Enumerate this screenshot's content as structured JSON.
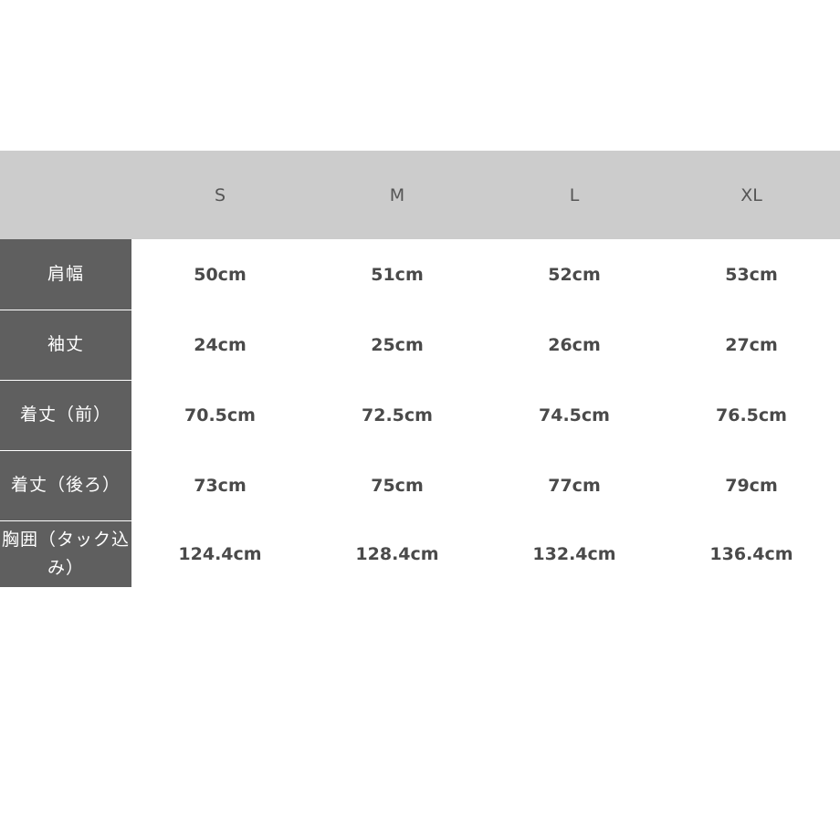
{
  "table": {
    "sizes": [
      "S",
      "M",
      "L",
      "XL"
    ],
    "rows": [
      {
        "label": "肩幅",
        "values": [
          "50cm",
          "51cm",
          "52cm",
          "53cm"
        ]
      },
      {
        "label": "袖丈",
        "values": [
          "24cm",
          "25cm",
          "26cm",
          "27cm"
        ]
      },
      {
        "label": "着丈（前）",
        "values": [
          "70.5cm",
          "72.5cm",
          "74.5cm",
          "76.5cm"
        ]
      },
      {
        "label": "着丈（後ろ）",
        "values": [
          "73cm",
          "75cm",
          "77cm",
          "79cm"
        ]
      },
      {
        "label": "胸囲（タック込み）",
        "values": [
          "124.4cm",
          "128.4cm",
          "132.4cm",
          "136.4cm"
        ]
      }
    ]
  }
}
